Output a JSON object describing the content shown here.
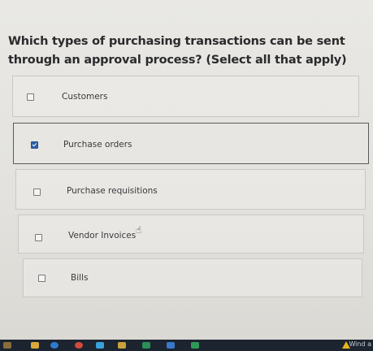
{
  "question": {
    "text": "Which types of purchasing transactions can be sent through an approval process? (Select all that apply)"
  },
  "options": [
    {
      "label": "Customers",
      "checked": false
    },
    {
      "label": "Purchase orders",
      "checked": true
    },
    {
      "label": "Purchase requisitions",
      "checked": false
    },
    {
      "label": "Vendor Invoices",
      "checked": false
    },
    {
      "label": "Bills",
      "checked": false
    }
  ],
  "taskbar": {
    "notification_text": "Wind a",
    "icons": [
      "weather-icon",
      "chrome-icon",
      "edge-icon",
      "file-explorer-icon",
      "store-icon",
      "mail-icon",
      "teams-icon",
      "word-icon",
      "excel-icon",
      "warning-icon"
    ]
  },
  "colors": {
    "checkbox_checked": "#2f5fa8",
    "question_text": "#2b2b2d",
    "option_border": "#c9c8c4"
  }
}
